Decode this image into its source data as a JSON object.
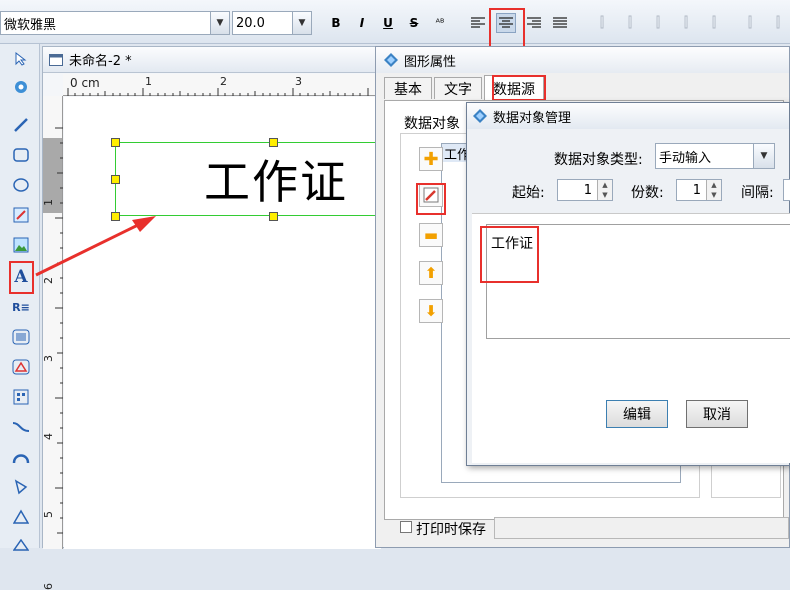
{
  "toolbar": {
    "font_name": "微软雅黑",
    "font_size": "20.0",
    "bold": "B",
    "italic": "I",
    "underline": "U",
    "strike": "S"
  },
  "document": {
    "title": "未命名-2 *",
    "ruler_unit": "0 cm",
    "h_ticks": [
      "1",
      "2",
      "3"
    ],
    "v_ticks": [
      "1",
      "2",
      "3",
      "4",
      "5",
      "6"
    ],
    "text_object": "工作证"
  },
  "props_dialog": {
    "title": "图形属性",
    "tabs": [
      "基本",
      "文字",
      "数据源"
    ],
    "section_label": "数据对象",
    "list_item": "工作",
    "print_save": "打印时保存"
  },
  "data_dialog": {
    "title": "数据对象管理",
    "type_label": "数据对象类型:",
    "type_value": "手动输入",
    "start_label": "起始:",
    "start_value": "1",
    "copies_label": "份数:",
    "copies_value": "1",
    "interval_label": "间隔:",
    "content": "工作证",
    "edit_button": "编辑",
    "cancel_button": "取消"
  },
  "colors": {
    "highlight": "#e8302c",
    "selection": "#33cc33",
    "handle": "#ffee00"
  }
}
